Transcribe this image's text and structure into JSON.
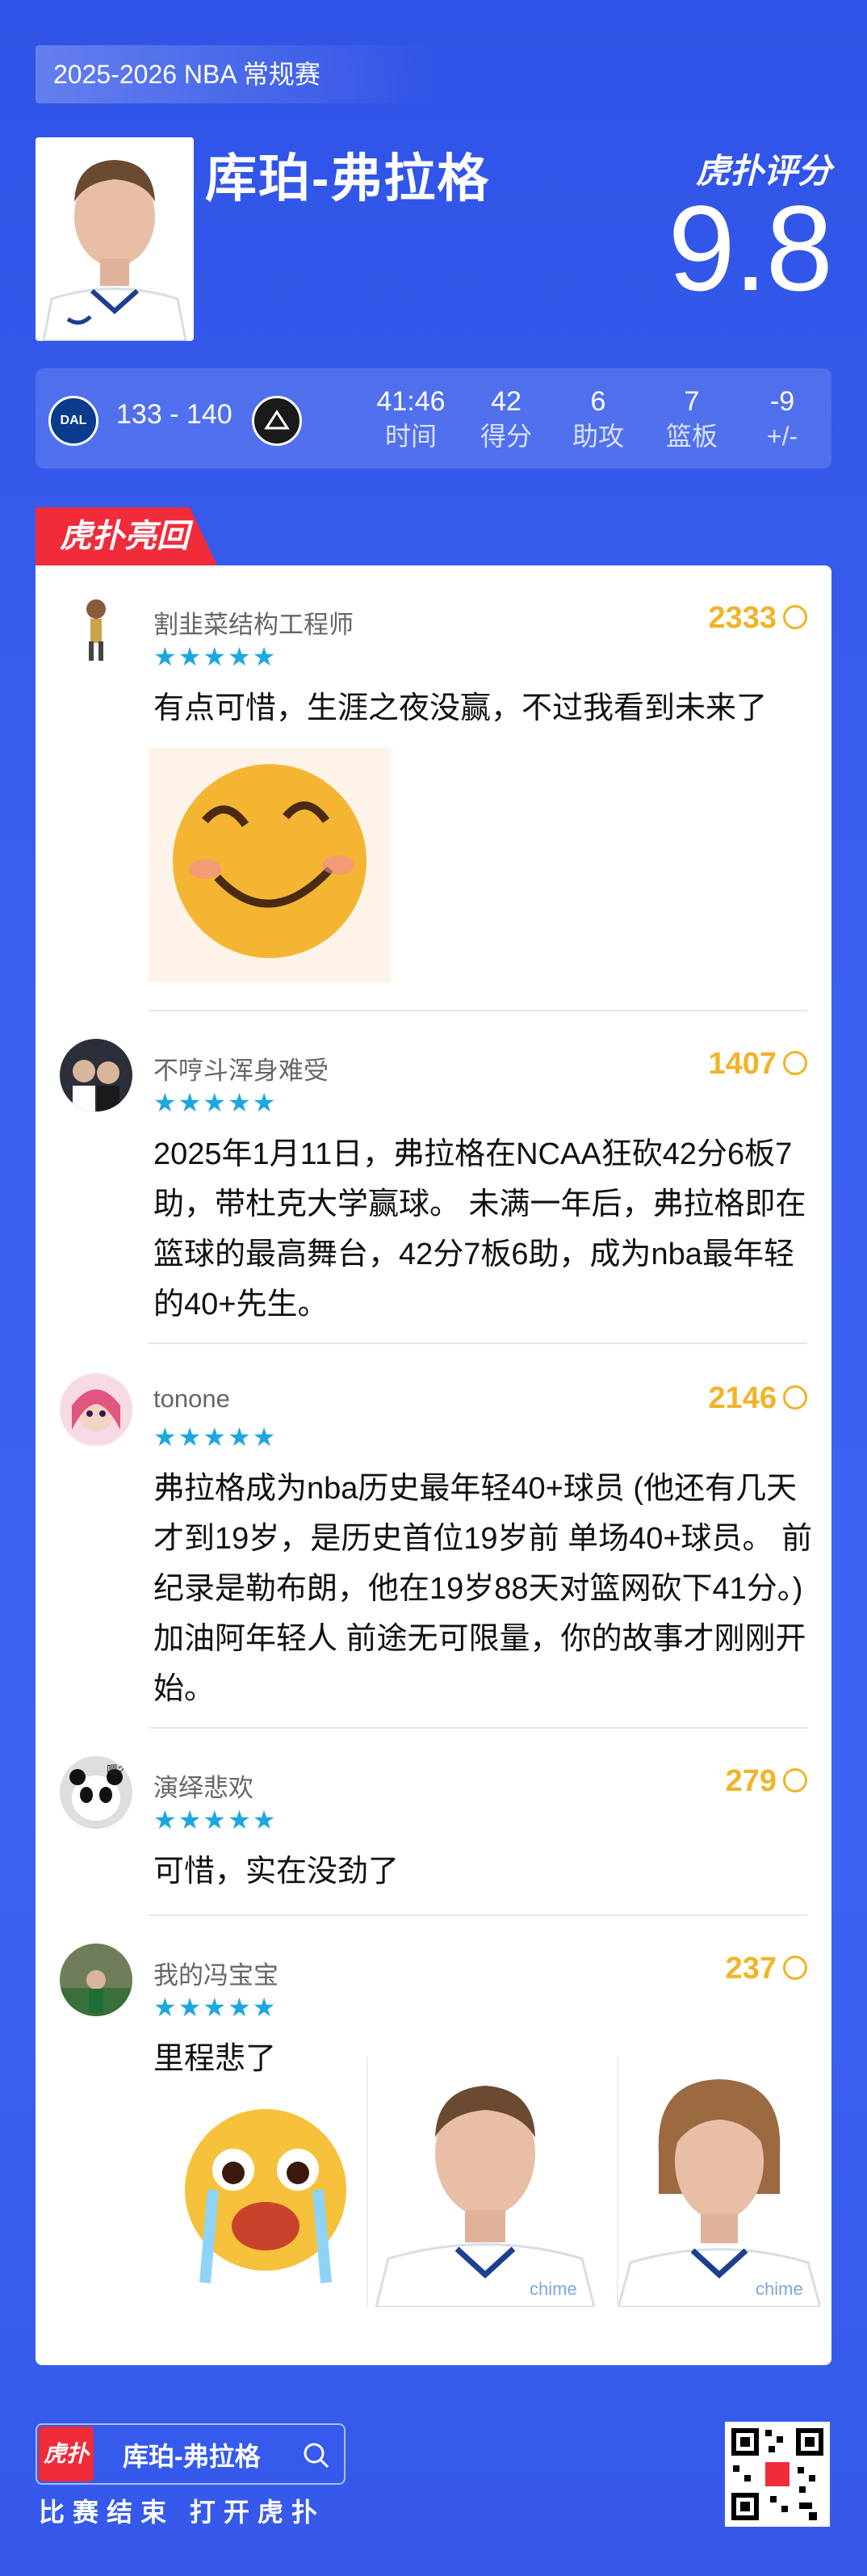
{
  "season": "2025-2026 NBA 常规赛",
  "player": {
    "name": "库珀-弗拉格",
    "rating": "9.8"
  },
  "brand": "虎扑评分",
  "game": {
    "home_team": "DAL",
    "score": "133 - 140",
    "stats": [
      {
        "value": "41:46",
        "label": "时间"
      },
      {
        "value": "42",
        "label": "得分"
      },
      {
        "value": "6",
        "label": "助攻"
      },
      {
        "value": "7",
        "label": "篮板"
      },
      {
        "value": "-9",
        "label": "+/-"
      }
    ]
  },
  "section_label": "虎扑亮回复",
  "comments": [
    {
      "user": "割韭菜结构工程师",
      "stars": "★★★★★",
      "likes": "2333",
      "text": "有点可惜，生涯之夜没赢，不过我看到未来了"
    },
    {
      "user": "不哼斗浑身难受",
      "stars": "★★★★★",
      "likes": "1407",
      "text": "2025年1月11日，弗拉格在NCAA狂砍42分6板7助，带杜克大学赢球。 未满一年后，弗拉格即在篮球的最高舞台，42分7板6助，成为nba最年轻的40+先生。"
    },
    {
      "user": "tonone",
      "stars": "★★★★★",
      "likes": "2146",
      "text": "弗拉格成为nba历史最年轻40+球员 (他还有几天才到19岁，是历史首位19岁前 单场40+球员。 前纪录是勒布朗，他在19岁88天对篮网砍下41分。) 加油阿年轻人 前途无可限量，你的故事才刚刚开始。"
    },
    {
      "user": "演绎悲欢",
      "stars": "★★★★★",
      "likes": "279",
      "text": "可惜，实在没劲了"
    },
    {
      "user": "我的冯宝宝",
      "stars": "★★★★★",
      "likes": "237",
      "text": "里程悲了"
    }
  ],
  "footer": {
    "logo": "虎扑",
    "search_text": "库珀-弗拉格",
    "tagline": "比赛结束 打开虎扑"
  },
  "jersey_text": "chime",
  "avatar_text_4": "嗯?"
}
